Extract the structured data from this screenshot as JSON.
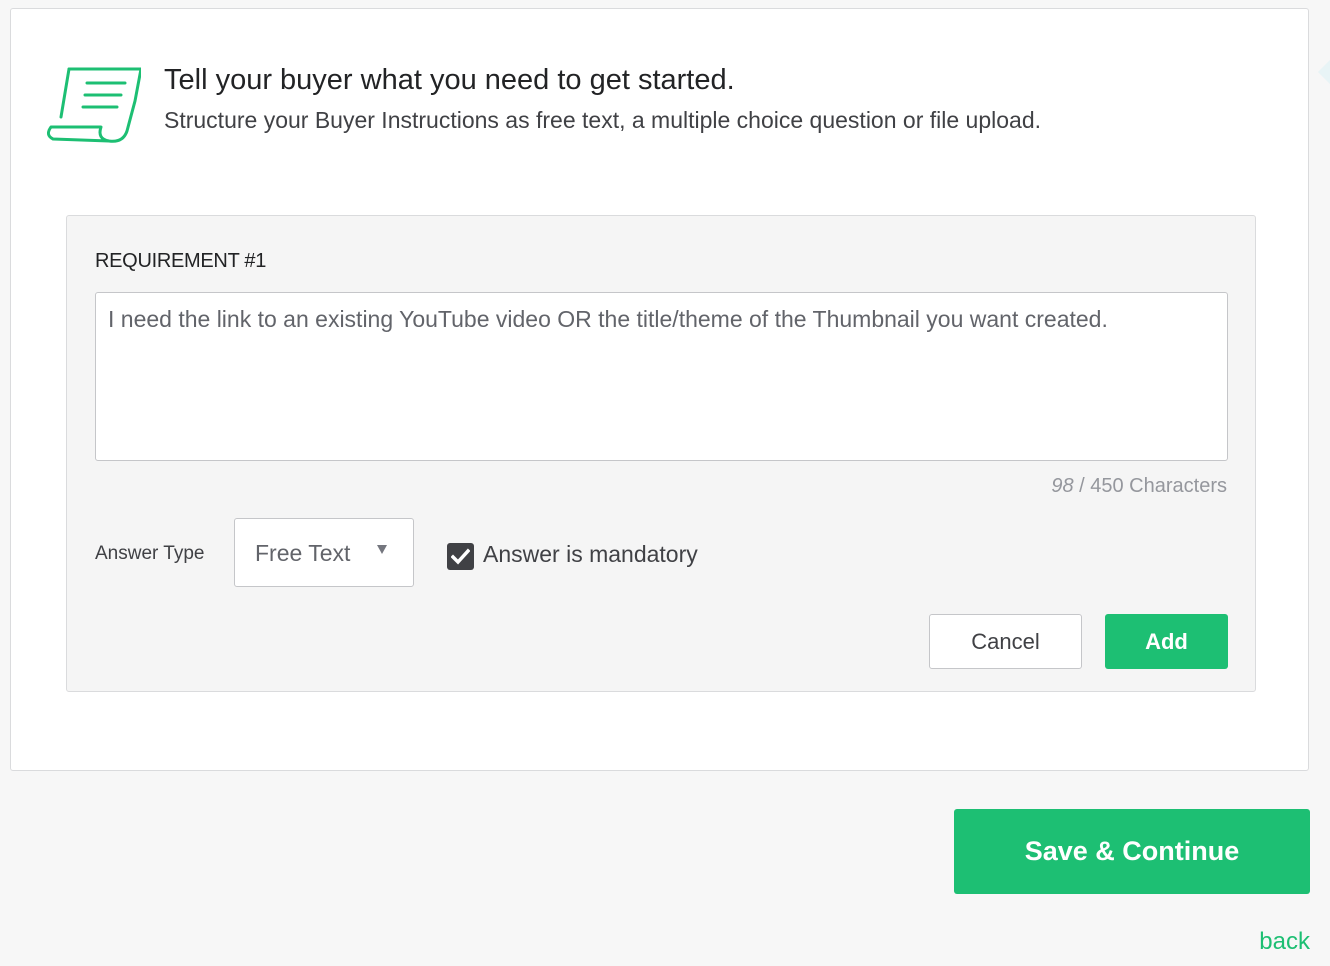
{
  "header": {
    "title": "Tell your buyer what you need to get started.",
    "subtitle": "Structure your Buyer Instructions as free text, a multiple choice question or file upload.",
    "icon": "scroll-document-icon"
  },
  "requirement": {
    "label": "REQUIREMENT #1",
    "text": "I need the link to an existing YouTube video OR the title/theme of the Thumbnail you want created.",
    "char_count_current": "98",
    "char_count_rest": " / 450 Characters",
    "answer_type_label": "Answer Type",
    "answer_type_value": "Free Text",
    "mandatory_label": "Answer is mandatory",
    "mandatory_checked": true,
    "cancel_label": "Cancel",
    "add_label": "Add"
  },
  "footer": {
    "save_label": "Save & Continue",
    "back_label": "back"
  },
  "colors": {
    "accent": "#1dbf73",
    "icon_stroke": "#1dbf73",
    "panel_bg": "#f5f5f5",
    "page_bg": "#f7f7f7"
  }
}
